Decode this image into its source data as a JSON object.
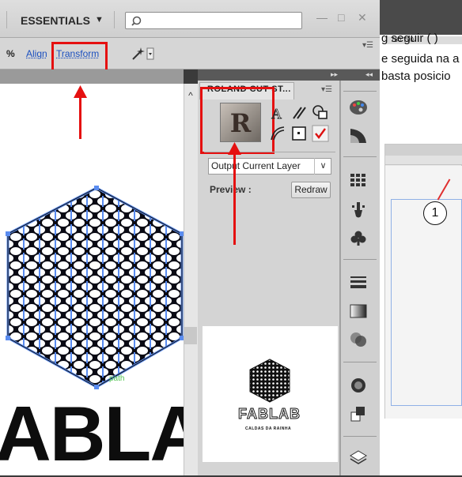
{
  "workspace": {
    "essentials_label": "ESSENTIALS",
    "caret": "▼",
    "minimize": "—",
    "maximize": "□",
    "close": "✕"
  },
  "controlbar": {
    "percent_label": "%",
    "align_label": "Align",
    "transform_label": "Transform",
    "menu_glyph": "▾☰"
  },
  "background_doc": {
    "ruler_marks": "780   790",
    "line1": "g seguir ( )",
    "line2": "e seguida na a",
    "line3": "basta posicio",
    "callout_number": "1"
  },
  "canvas": {
    "selection_label": "path",
    "logo_text": "ABLA",
    "scroll_up": "^"
  },
  "roland_panel": {
    "title": "ROLAND CUT ST...",
    "logo_letter": "R",
    "output_select_value": "Output Current Layer",
    "output_caret": "∨",
    "preview_label": "Preview :",
    "redraw_label": "Redraw",
    "preview_logo": "FABLAB",
    "preview_subtitle": "CALDAS DA RAINHA",
    "panel_menu": "▾☰",
    "collapse_arrows": "▸▸",
    "collapse_arrows2": "◂◂"
  },
  "colors": {
    "annotation_red": "#e51010",
    "link_blue": "#1a4fbf",
    "selection_blue": "#5a8cf0"
  }
}
